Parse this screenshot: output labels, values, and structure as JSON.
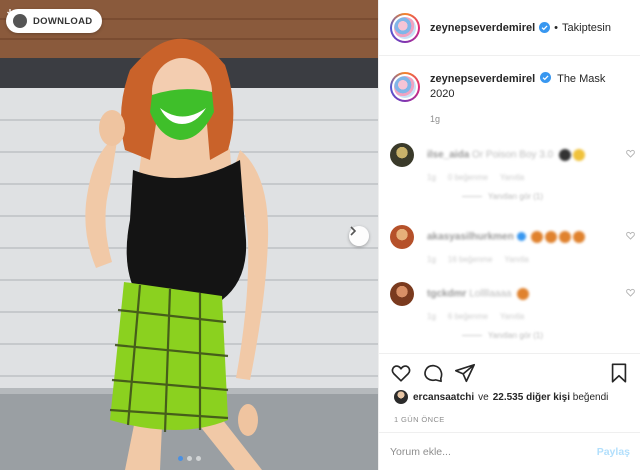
{
  "photo": {
    "download_label": "DOWNLOAD",
    "carousel_dots": 3,
    "active_dot": 1
  },
  "header": {
    "username": "zeynepsever​demirel",
    "separator": "•",
    "follow_label": "Takiptesin"
  },
  "caption": {
    "username": "zeynepsever​demirel",
    "text": "The Mask",
    "year": "2020",
    "time": "1g"
  },
  "comments": [
    {
      "username": "ilse_aida",
      "text": "Or Poison Boy 3.0",
      "time": "1g",
      "likes": "0 beğenme",
      "reply": "Yanıtla",
      "view_replies": "Yanıtları gör (1)"
    },
    {
      "username": "akasyasilhurkmen",
      "text": "",
      "time": "1g",
      "likes": "16 beğenme",
      "reply": "Yanıtla"
    },
    {
      "username": "tgckdmr",
      "text": "Lollllaaaa",
      "time": "1g",
      "likes": "6 beğenme",
      "reply": "Yanıtla",
      "view_replies": "Yanıtları gör (1)"
    }
  ],
  "likes": {
    "liker": "ercansaatchi",
    "connector": "ve",
    "count": "22.535 diğer kişi",
    "suffix": "beğendi"
  },
  "post_date": "1 GÜN ÖNCE",
  "add_comment": {
    "placeholder": "Yorum ekle...",
    "share_label": "Paylaş"
  },
  "colors": {
    "verified": "#3897f0",
    "share_disabled": "#b2dffc",
    "skirt_green": "#8bd11f"
  }
}
